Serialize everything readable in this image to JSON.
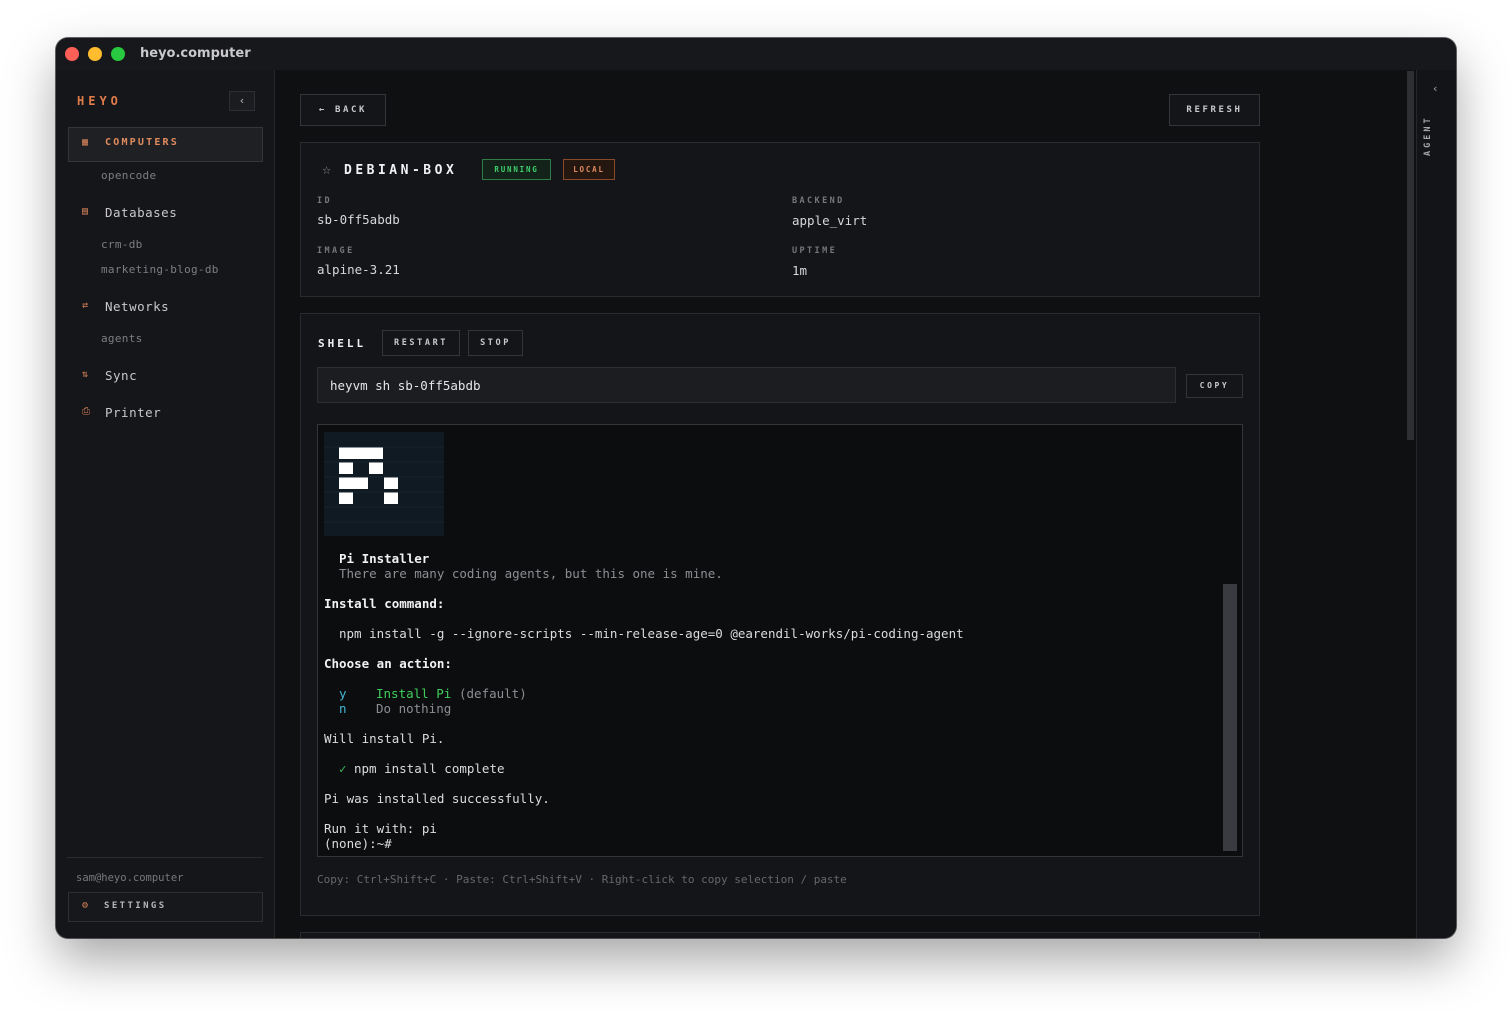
{
  "window": {
    "title": "heyo.computer"
  },
  "sidebar": {
    "brand": "HEYO",
    "collapse_icon": "‹",
    "items": [
      {
        "label": "COMPUTERS",
        "icon": "grid-icon",
        "active": true,
        "children": [
          "opencode"
        ]
      },
      {
        "label": "Databases",
        "icon": "database-icon",
        "active": false,
        "children": [
          "crm-db",
          "marketing-blog-db"
        ]
      },
      {
        "label": "Networks",
        "icon": "network-icon",
        "active": false,
        "children": [
          "agents"
        ]
      },
      {
        "label": "Sync",
        "icon": "sync-icon",
        "active": false,
        "children": []
      },
      {
        "label": "Printer",
        "icon": "printer-icon",
        "active": false,
        "children": []
      }
    ],
    "user_email": "sam@heyo.computer",
    "settings_label": "SETTINGS"
  },
  "toolbar": {
    "back_label": "← BACK",
    "refresh_label": "REFRESH"
  },
  "computer": {
    "name": "DEBIAN-BOX",
    "status_badge": "RUNNING",
    "location_badge": "LOCAL",
    "fields": {
      "id_label": "ID",
      "id_value": "sb-0ff5abdb",
      "backend_label": "BACKEND",
      "backend_value": "apple_virt",
      "image_label": "IMAGE",
      "image_value": "alpine-3.21",
      "uptime_label": "UPTIME",
      "uptime_value": "1m"
    }
  },
  "shell": {
    "title": "SHELL",
    "restart_label": "RESTART",
    "stop_label": "STOP",
    "command": "heyvm sh sb-0ff5abdb",
    "copy_label": "COPY",
    "terminal": {
      "installer_title": "Pi Installer",
      "installer_tagline": "There are many coding agents, but this one is mine.",
      "install_heading": "Install command:",
      "install_cmd": "npm install -g --ignore-scripts --min-release-age=0 @earendil-works/pi-coding-agent",
      "choose_heading": "Choose an action:",
      "option_y_key": "y",
      "option_y_label": "Install Pi",
      "option_y_note": "(default)",
      "option_n_key": "n",
      "option_n_label": "Do nothing",
      "will_install": "Will install Pi.",
      "check_mark": "✓",
      "npm_done": "npm install complete",
      "success": "Pi was installed successfully.",
      "run_it": "Run it with: pi",
      "prompt": "(none):~#"
    },
    "hint": "Copy: Ctrl+Shift+C · Paste: Ctrl+Shift+V · Right-click to copy selection / paste"
  },
  "agent_panel": {
    "label": "AGENT",
    "chevron": "‹"
  },
  "colors": {
    "accent": "#e07b4a",
    "running": "#3ecf6c",
    "terminal_cyan": "#41b7d6",
    "terminal_green": "#3fce5c"
  }
}
